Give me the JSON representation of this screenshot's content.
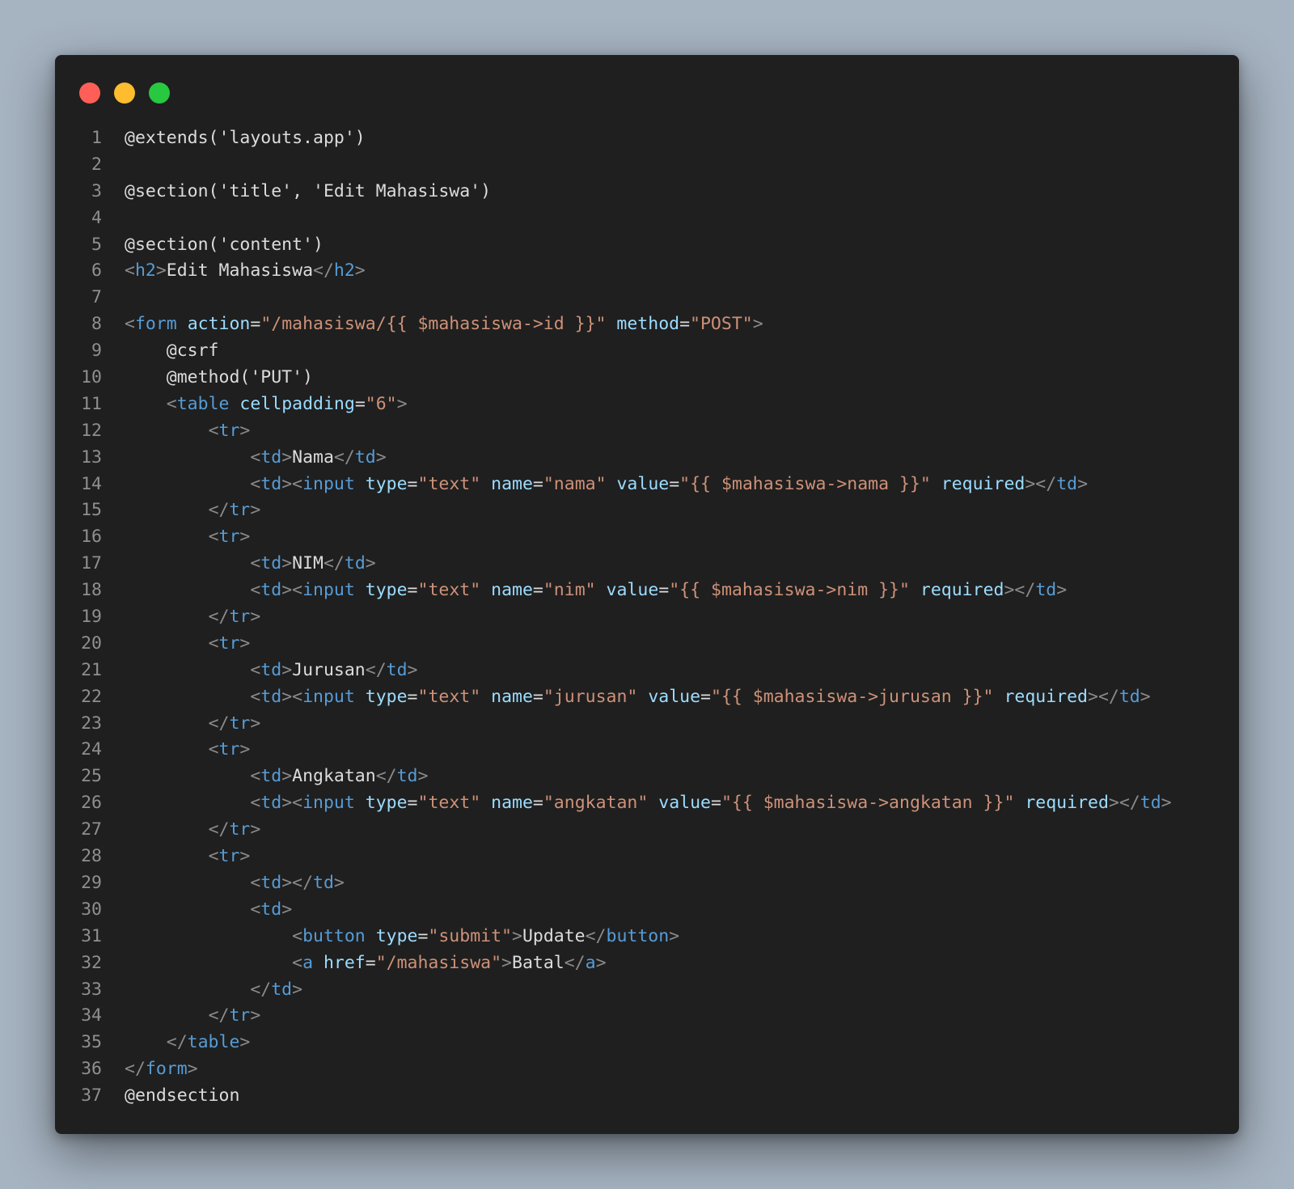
{
  "window": {
    "controls": {
      "close_color": "#ff5f57",
      "minimize_color": "#febc2e",
      "maximize_color": "#28c840"
    }
  },
  "theme": {
    "text": "#dcdcdc",
    "punctuation": "#8a8a8a",
    "tag": "#569cd6",
    "attribute": "#9cdcfe",
    "string": "#ce9178",
    "line_number": "#8f8f8f",
    "background": "#1f1f1f"
  },
  "lines": [
    [
      {
        "t": "txt",
        "v": "@extends('layouts.app')"
      }
    ],
    [],
    [
      {
        "t": "txt",
        "v": "@section('title', 'Edit Mahasiswa')"
      }
    ],
    [],
    [
      {
        "t": "txt",
        "v": "@section('content')"
      }
    ],
    [
      {
        "t": "punc",
        "v": "<"
      },
      {
        "t": "tag",
        "v": "h2"
      },
      {
        "t": "punc",
        "v": ">"
      },
      {
        "t": "txt",
        "v": "Edit Mahasiswa"
      },
      {
        "t": "punc",
        "v": "</"
      },
      {
        "t": "tag",
        "v": "h2"
      },
      {
        "t": "punc",
        "v": ">"
      }
    ],
    [],
    [
      {
        "t": "punc",
        "v": "<"
      },
      {
        "t": "tag",
        "v": "form"
      },
      {
        "t": "txt",
        "v": " "
      },
      {
        "t": "attr",
        "v": "action"
      },
      {
        "t": "txt",
        "v": "="
      },
      {
        "t": "str",
        "v": "\"/mahasiswa/{{ $mahasiswa->id }}\""
      },
      {
        "t": "txt",
        "v": " "
      },
      {
        "t": "attr",
        "v": "method"
      },
      {
        "t": "txt",
        "v": "="
      },
      {
        "t": "str",
        "v": "\"POST\""
      },
      {
        "t": "punc",
        "v": ">"
      }
    ],
    [
      {
        "t": "txt",
        "v": "    @csrf"
      }
    ],
    [
      {
        "t": "txt",
        "v": "    @method('PUT')"
      }
    ],
    [
      {
        "t": "txt",
        "v": "    "
      },
      {
        "t": "punc",
        "v": "<"
      },
      {
        "t": "tag",
        "v": "table"
      },
      {
        "t": "txt",
        "v": " "
      },
      {
        "t": "attr",
        "v": "cellpadding"
      },
      {
        "t": "txt",
        "v": "="
      },
      {
        "t": "str",
        "v": "\"6\""
      },
      {
        "t": "punc",
        "v": ">"
      }
    ],
    [
      {
        "t": "txt",
        "v": "        "
      },
      {
        "t": "punc",
        "v": "<"
      },
      {
        "t": "tag",
        "v": "tr"
      },
      {
        "t": "punc",
        "v": ">"
      }
    ],
    [
      {
        "t": "txt",
        "v": "            "
      },
      {
        "t": "punc",
        "v": "<"
      },
      {
        "t": "tag",
        "v": "td"
      },
      {
        "t": "punc",
        "v": ">"
      },
      {
        "t": "txt",
        "v": "Nama"
      },
      {
        "t": "punc",
        "v": "</"
      },
      {
        "t": "tag",
        "v": "td"
      },
      {
        "t": "punc",
        "v": ">"
      }
    ],
    [
      {
        "t": "txt",
        "v": "            "
      },
      {
        "t": "punc",
        "v": "<"
      },
      {
        "t": "tag",
        "v": "td"
      },
      {
        "t": "punc",
        "v": "><"
      },
      {
        "t": "tag",
        "v": "input"
      },
      {
        "t": "txt",
        "v": " "
      },
      {
        "t": "attr",
        "v": "type"
      },
      {
        "t": "txt",
        "v": "="
      },
      {
        "t": "str",
        "v": "\"text\""
      },
      {
        "t": "txt",
        "v": " "
      },
      {
        "t": "attr",
        "v": "name"
      },
      {
        "t": "txt",
        "v": "="
      },
      {
        "t": "str",
        "v": "\"nama\""
      },
      {
        "t": "txt",
        "v": " "
      },
      {
        "t": "attr",
        "v": "value"
      },
      {
        "t": "txt",
        "v": "="
      },
      {
        "t": "str",
        "v": "\"{{ $mahasiswa->nama }}\""
      },
      {
        "t": "txt",
        "v": " "
      },
      {
        "t": "attr",
        "v": "required"
      },
      {
        "t": "punc",
        "v": "></"
      },
      {
        "t": "tag",
        "v": "td"
      },
      {
        "t": "punc",
        "v": ">"
      }
    ],
    [
      {
        "t": "txt",
        "v": "        "
      },
      {
        "t": "punc",
        "v": "</"
      },
      {
        "t": "tag",
        "v": "tr"
      },
      {
        "t": "punc",
        "v": ">"
      }
    ],
    [
      {
        "t": "txt",
        "v": "        "
      },
      {
        "t": "punc",
        "v": "<"
      },
      {
        "t": "tag",
        "v": "tr"
      },
      {
        "t": "punc",
        "v": ">"
      }
    ],
    [
      {
        "t": "txt",
        "v": "            "
      },
      {
        "t": "punc",
        "v": "<"
      },
      {
        "t": "tag",
        "v": "td"
      },
      {
        "t": "punc",
        "v": ">"
      },
      {
        "t": "txt",
        "v": "NIM"
      },
      {
        "t": "punc",
        "v": "</"
      },
      {
        "t": "tag",
        "v": "td"
      },
      {
        "t": "punc",
        "v": ">"
      }
    ],
    [
      {
        "t": "txt",
        "v": "            "
      },
      {
        "t": "punc",
        "v": "<"
      },
      {
        "t": "tag",
        "v": "td"
      },
      {
        "t": "punc",
        "v": "><"
      },
      {
        "t": "tag",
        "v": "input"
      },
      {
        "t": "txt",
        "v": " "
      },
      {
        "t": "attr",
        "v": "type"
      },
      {
        "t": "txt",
        "v": "="
      },
      {
        "t": "str",
        "v": "\"text\""
      },
      {
        "t": "txt",
        "v": " "
      },
      {
        "t": "attr",
        "v": "name"
      },
      {
        "t": "txt",
        "v": "="
      },
      {
        "t": "str",
        "v": "\"nim\""
      },
      {
        "t": "txt",
        "v": " "
      },
      {
        "t": "attr",
        "v": "value"
      },
      {
        "t": "txt",
        "v": "="
      },
      {
        "t": "str",
        "v": "\"{{ $mahasiswa->nim }}\""
      },
      {
        "t": "txt",
        "v": " "
      },
      {
        "t": "attr",
        "v": "required"
      },
      {
        "t": "punc",
        "v": "></"
      },
      {
        "t": "tag",
        "v": "td"
      },
      {
        "t": "punc",
        "v": ">"
      }
    ],
    [
      {
        "t": "txt",
        "v": "        "
      },
      {
        "t": "punc",
        "v": "</"
      },
      {
        "t": "tag",
        "v": "tr"
      },
      {
        "t": "punc",
        "v": ">"
      }
    ],
    [
      {
        "t": "txt",
        "v": "        "
      },
      {
        "t": "punc",
        "v": "<"
      },
      {
        "t": "tag",
        "v": "tr"
      },
      {
        "t": "punc",
        "v": ">"
      }
    ],
    [
      {
        "t": "txt",
        "v": "            "
      },
      {
        "t": "punc",
        "v": "<"
      },
      {
        "t": "tag",
        "v": "td"
      },
      {
        "t": "punc",
        "v": ">"
      },
      {
        "t": "txt",
        "v": "Jurusan"
      },
      {
        "t": "punc",
        "v": "</"
      },
      {
        "t": "tag",
        "v": "td"
      },
      {
        "t": "punc",
        "v": ">"
      }
    ],
    [
      {
        "t": "txt",
        "v": "            "
      },
      {
        "t": "punc",
        "v": "<"
      },
      {
        "t": "tag",
        "v": "td"
      },
      {
        "t": "punc",
        "v": "><"
      },
      {
        "t": "tag",
        "v": "input"
      },
      {
        "t": "txt",
        "v": " "
      },
      {
        "t": "attr",
        "v": "type"
      },
      {
        "t": "txt",
        "v": "="
      },
      {
        "t": "str",
        "v": "\"text\""
      },
      {
        "t": "txt",
        "v": " "
      },
      {
        "t": "attr",
        "v": "name"
      },
      {
        "t": "txt",
        "v": "="
      },
      {
        "t": "str",
        "v": "\"jurusan\""
      },
      {
        "t": "txt",
        "v": " "
      },
      {
        "t": "attr",
        "v": "value"
      },
      {
        "t": "txt",
        "v": "="
      },
      {
        "t": "str",
        "v": "\"{{ $mahasiswa->jurusan }}\""
      },
      {
        "t": "txt",
        "v": " "
      },
      {
        "t": "attr",
        "v": "required"
      },
      {
        "t": "punc",
        "v": "></"
      },
      {
        "t": "tag",
        "v": "td"
      },
      {
        "t": "punc",
        "v": ">"
      }
    ],
    [
      {
        "t": "txt",
        "v": "        "
      },
      {
        "t": "punc",
        "v": "</"
      },
      {
        "t": "tag",
        "v": "tr"
      },
      {
        "t": "punc",
        "v": ">"
      }
    ],
    [
      {
        "t": "txt",
        "v": "        "
      },
      {
        "t": "punc",
        "v": "<"
      },
      {
        "t": "tag",
        "v": "tr"
      },
      {
        "t": "punc",
        "v": ">"
      }
    ],
    [
      {
        "t": "txt",
        "v": "            "
      },
      {
        "t": "punc",
        "v": "<"
      },
      {
        "t": "tag",
        "v": "td"
      },
      {
        "t": "punc",
        "v": ">"
      },
      {
        "t": "txt",
        "v": "Angkatan"
      },
      {
        "t": "punc",
        "v": "</"
      },
      {
        "t": "tag",
        "v": "td"
      },
      {
        "t": "punc",
        "v": ">"
      }
    ],
    [
      {
        "t": "txt",
        "v": "            "
      },
      {
        "t": "punc",
        "v": "<"
      },
      {
        "t": "tag",
        "v": "td"
      },
      {
        "t": "punc",
        "v": "><"
      },
      {
        "t": "tag",
        "v": "input"
      },
      {
        "t": "txt",
        "v": " "
      },
      {
        "t": "attr",
        "v": "type"
      },
      {
        "t": "txt",
        "v": "="
      },
      {
        "t": "str",
        "v": "\"text\""
      },
      {
        "t": "txt",
        "v": " "
      },
      {
        "t": "attr",
        "v": "name"
      },
      {
        "t": "txt",
        "v": "="
      },
      {
        "t": "str",
        "v": "\"angkatan\""
      },
      {
        "t": "txt",
        "v": " "
      },
      {
        "t": "attr",
        "v": "value"
      },
      {
        "t": "txt",
        "v": "="
      },
      {
        "t": "str",
        "v": "\"{{ $mahasiswa->angkatan }}\""
      },
      {
        "t": "txt",
        "v": " "
      },
      {
        "t": "attr",
        "v": "required"
      },
      {
        "t": "punc",
        "v": "></"
      },
      {
        "t": "tag",
        "v": "td"
      },
      {
        "t": "punc",
        "v": ">"
      }
    ],
    [
      {
        "t": "txt",
        "v": "        "
      },
      {
        "t": "punc",
        "v": "</"
      },
      {
        "t": "tag",
        "v": "tr"
      },
      {
        "t": "punc",
        "v": ">"
      }
    ],
    [
      {
        "t": "txt",
        "v": "        "
      },
      {
        "t": "punc",
        "v": "<"
      },
      {
        "t": "tag",
        "v": "tr"
      },
      {
        "t": "punc",
        "v": ">"
      }
    ],
    [
      {
        "t": "txt",
        "v": "            "
      },
      {
        "t": "punc",
        "v": "<"
      },
      {
        "t": "tag",
        "v": "td"
      },
      {
        "t": "punc",
        "v": "></"
      },
      {
        "t": "tag",
        "v": "td"
      },
      {
        "t": "punc",
        "v": ">"
      }
    ],
    [
      {
        "t": "txt",
        "v": "            "
      },
      {
        "t": "punc",
        "v": "<"
      },
      {
        "t": "tag",
        "v": "td"
      },
      {
        "t": "punc",
        "v": ">"
      }
    ],
    [
      {
        "t": "txt",
        "v": "                "
      },
      {
        "t": "punc",
        "v": "<"
      },
      {
        "t": "tag",
        "v": "button"
      },
      {
        "t": "txt",
        "v": " "
      },
      {
        "t": "attr",
        "v": "type"
      },
      {
        "t": "txt",
        "v": "="
      },
      {
        "t": "str",
        "v": "\"submit\""
      },
      {
        "t": "punc",
        "v": ">"
      },
      {
        "t": "txt",
        "v": "Update"
      },
      {
        "t": "punc",
        "v": "</"
      },
      {
        "t": "tag",
        "v": "button"
      },
      {
        "t": "punc",
        "v": ">"
      }
    ],
    [
      {
        "t": "txt",
        "v": "                "
      },
      {
        "t": "punc",
        "v": "<"
      },
      {
        "t": "tag",
        "v": "a"
      },
      {
        "t": "txt",
        "v": " "
      },
      {
        "t": "attr",
        "v": "href"
      },
      {
        "t": "txt",
        "v": "="
      },
      {
        "t": "str",
        "v": "\"/mahasiswa\""
      },
      {
        "t": "punc",
        "v": ">"
      },
      {
        "t": "txt",
        "v": "Batal"
      },
      {
        "t": "punc",
        "v": "</"
      },
      {
        "t": "tag",
        "v": "a"
      },
      {
        "t": "punc",
        "v": ">"
      }
    ],
    [
      {
        "t": "txt",
        "v": "            "
      },
      {
        "t": "punc",
        "v": "</"
      },
      {
        "t": "tag",
        "v": "td"
      },
      {
        "t": "punc",
        "v": ">"
      }
    ],
    [
      {
        "t": "txt",
        "v": "        "
      },
      {
        "t": "punc",
        "v": "</"
      },
      {
        "t": "tag",
        "v": "tr"
      },
      {
        "t": "punc",
        "v": ">"
      }
    ],
    [
      {
        "t": "txt",
        "v": "    "
      },
      {
        "t": "punc",
        "v": "</"
      },
      {
        "t": "tag",
        "v": "table"
      },
      {
        "t": "punc",
        "v": ">"
      }
    ],
    [
      {
        "t": "punc",
        "v": "</"
      },
      {
        "t": "tag",
        "v": "form"
      },
      {
        "t": "punc",
        "v": ">"
      }
    ],
    [
      {
        "t": "txt",
        "v": "@endsection"
      }
    ]
  ]
}
